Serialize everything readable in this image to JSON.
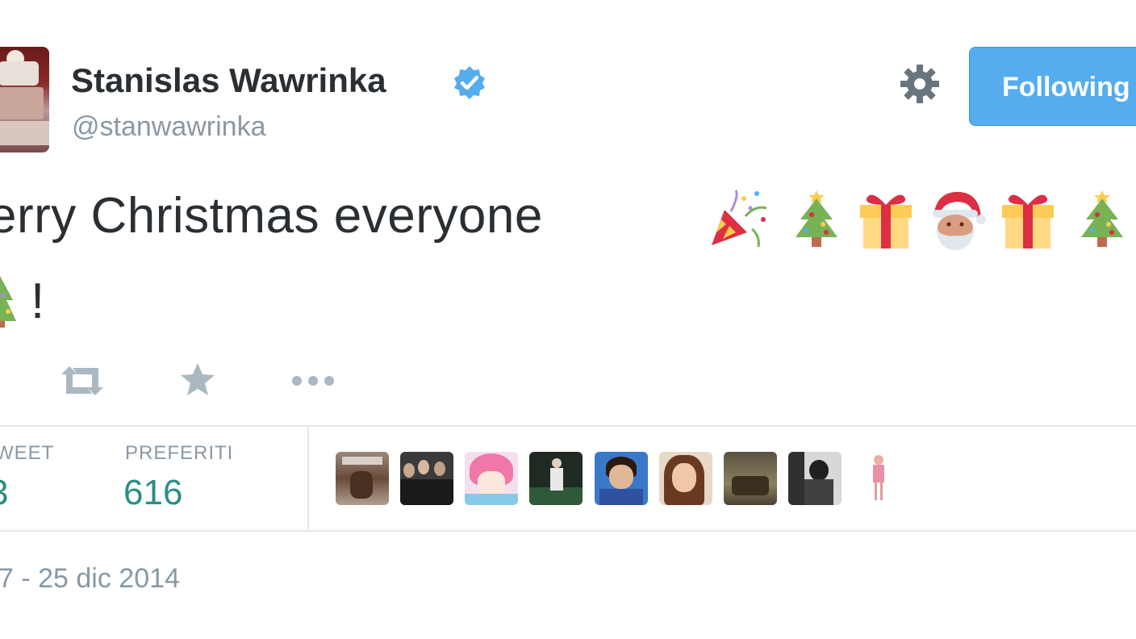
{
  "author": {
    "name": "Stanislas Wawrinka",
    "handle": "@stanwawrinka",
    "verified": true
  },
  "header": {
    "follow_button_label": "Following"
  },
  "tweet": {
    "text_line1": "erry Christmas everyone",
    "text_line2": "!",
    "emojis": [
      "party-popper",
      "christmas-tree",
      "wrapped-gift",
      "santa-claus",
      "wrapped-gift",
      "christmas-tree"
    ]
  },
  "actions": {
    "icons": [
      "retweet-icon",
      "favorite-star-icon",
      "more-icon"
    ]
  },
  "stats": {
    "retweets_label": "WEET",
    "retweets_value": "3",
    "favorites_label": "PREFERITI",
    "favorites_value": "616"
  },
  "favorited_by_count_shown": 9,
  "timestamp": "7 - 25 dic 2014",
  "colors": {
    "accent": "#55acee",
    "stat_value": "#2a8d86",
    "muted": "#8899a6",
    "verified": "#55acee"
  }
}
